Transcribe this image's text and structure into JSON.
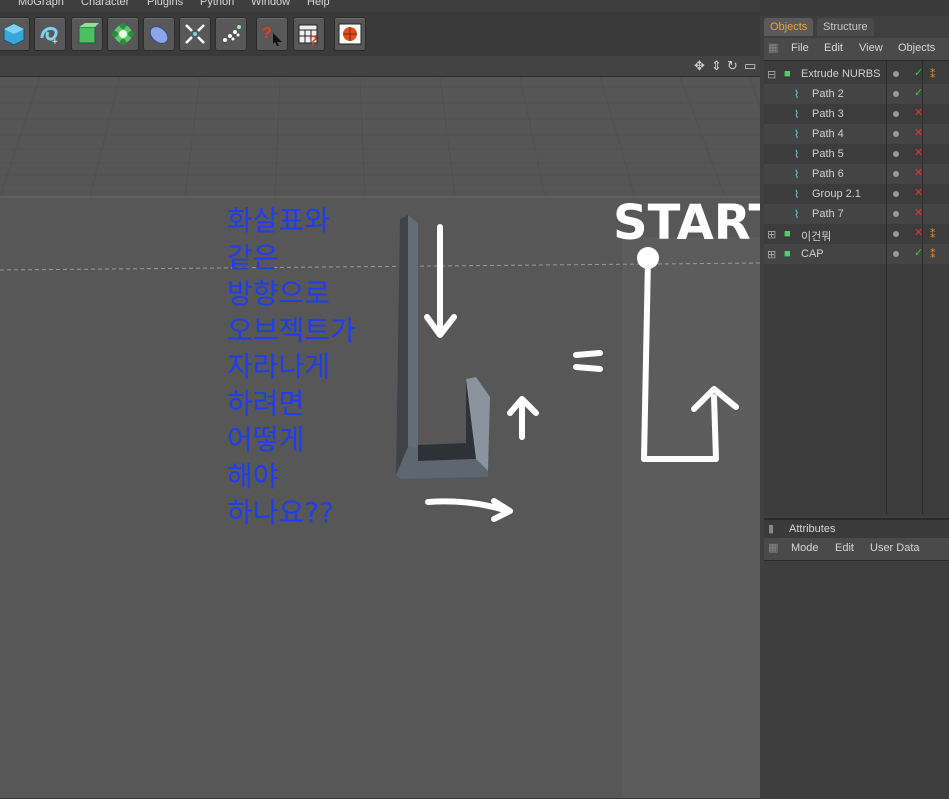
{
  "menu": {
    "items": [
      "MoGraph",
      "Character",
      "Plugins",
      "Python",
      "Window",
      "Help"
    ]
  },
  "toolbar": {
    "buttons": [
      "cube-icon",
      "spline-pen-icon",
      "nurbs-icon",
      "array-cloner-icon",
      "deformer-icon",
      "scene-icon",
      "particles-icon",
      "help-cursor-icon",
      "timeline-help-icon",
      "render-sphere-icon"
    ]
  },
  "viewport": {
    "question_lines": [
      "화살표와",
      "같은",
      "방향으로",
      "오브젝트가",
      "자라나게",
      "하려면",
      "어떻게",
      "해야",
      "하나요??"
    ],
    "start_label": "START",
    "equals_sign": "="
  },
  "objects_panel": {
    "tabs": [
      "Objects",
      "Structure"
    ],
    "menu": [
      "File",
      "Edit",
      "View",
      "Objects"
    ],
    "items": [
      {
        "label": "Extrude NURBS",
        "level": 0,
        "status": "check"
      },
      {
        "label": "Path 2",
        "level": 1,
        "status": "check"
      },
      {
        "label": "Path 3",
        "level": 1,
        "status": "cross"
      },
      {
        "label": "Path 4",
        "level": 1,
        "status": "cross"
      },
      {
        "label": "Path 5",
        "level": 1,
        "status": "cross"
      },
      {
        "label": "Path 6",
        "level": 1,
        "status": "cross"
      },
      {
        "label": "Group 2.1",
        "level": 1,
        "status": "cross"
      },
      {
        "label": "Path 7",
        "level": 1,
        "status": "cross"
      },
      {
        "label": "이건뭐",
        "level": 0,
        "status": "cross"
      },
      {
        "label": "CAP",
        "level": 0,
        "status": "check"
      }
    ]
  },
  "attributes_panel": {
    "title": "Attributes",
    "menu": [
      "Mode",
      "Edit",
      "User Data"
    ]
  },
  "colors": {
    "accent": "#f0a030",
    "check": "#33cc33",
    "cross": "#e03a2a",
    "question_text": "#1e3df0"
  }
}
